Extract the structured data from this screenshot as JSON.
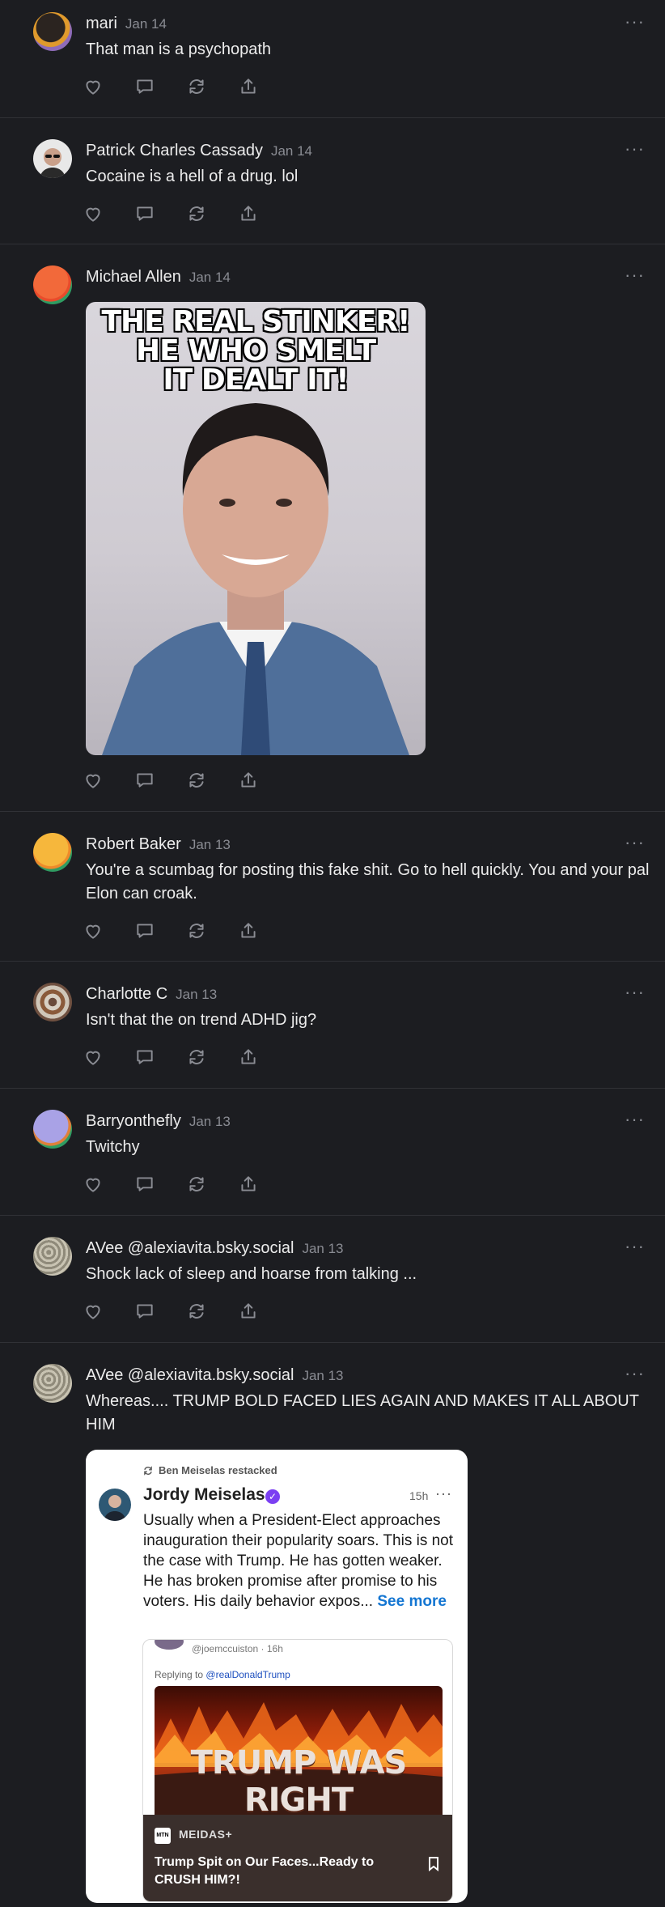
{
  "colors": {
    "background": "#1c1d21",
    "text": "#ececec",
    "muted": "#8a8c93",
    "divider": "#303136",
    "link": "#1476d2",
    "verified": "#7b3ff2"
  },
  "actions_icons": [
    "heart-icon",
    "reply-icon",
    "repost-icon",
    "share-icon"
  ],
  "more_label": "···",
  "posts": [
    {
      "name": "mari",
      "date": "Jan 14",
      "text": "That man is a psychopath",
      "avatar": "orange-purple-circle"
    },
    {
      "name": "Patrick Charles Cassady",
      "date": "Jan 14",
      "text": "Cocaine is a hell of a drug. lol",
      "avatar": "man-with-sunglasses-photo"
    },
    {
      "name": "Michael Allen",
      "date": "Jan 14",
      "text": "",
      "avatar": "red-orange-circle",
      "meme_caption": [
        "THE REAL STINKER!",
        "HE WHO SMELT",
        "IT DEALT IT!"
      ]
    },
    {
      "name": "Robert Baker",
      "date": "Jan 13",
      "text": "You're a scumbag for posting this fake shit. Go to hell quickly. You and your pal Elon can croak.",
      "avatar": "yellow-orange-circle"
    },
    {
      "name": "Charlotte C",
      "date": "Jan 13",
      "text": "Isn't that the on trend ADHD jig?",
      "avatar": "mandala-photo"
    },
    {
      "name": "Barryonthefly",
      "date": "Jan 13",
      "text": "Twitchy",
      "avatar": "lavender-circle"
    },
    {
      "name": "AVee @alexiavita.bsky.social",
      "date": "Jan 13",
      "text": "Shock lack of sleep and hoarse from talking ...",
      "avatar": "lace-photo"
    },
    {
      "name": "AVee @alexiavita.bsky.social",
      "date": "Jan 13",
      "text": "Whereas.... TRUMP BOLD FACED LIES AGAIN AND MAKES IT ALL ABOUT HIM",
      "avatar": "lace-photo"
    }
  ],
  "embed": {
    "restacked_by": "Ben Meiselas restacked",
    "author": "Jordy Meiselas",
    "time": "15h",
    "text": "Usually when a President-Elect approaches inauguration their popularity soars. This is not the case with Trump. He has gotten weaker. He has broken promise after promise to his voters. His daily behavior expos...",
    "see_more": "See more",
    "quote": {
      "handle": "@joemccuiston · 16h",
      "reply_prefix": "Replying to",
      "reply_to": "@realDonaldTrump",
      "image_text": "TRUMP WAS RIGHT",
      "source_logo": "MTN",
      "source": "MEIDAS+",
      "title": "Trump Spit on Our Faces...Ready to CRUSH HIM?!"
    }
  }
}
